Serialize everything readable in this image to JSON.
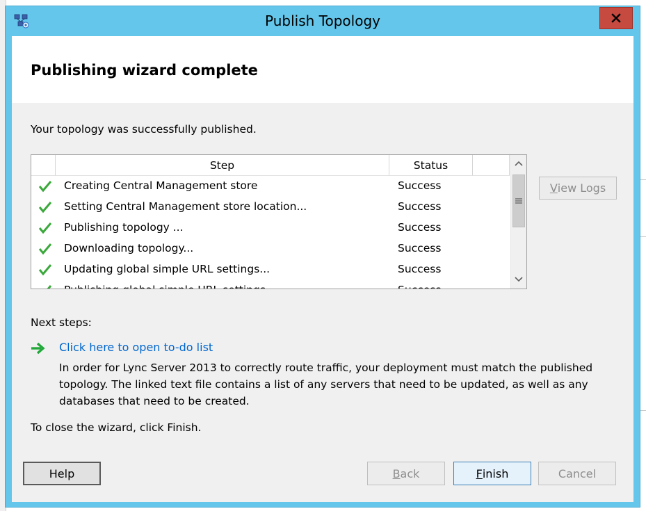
{
  "window": {
    "title": "Publish Topology",
    "close_label": "x"
  },
  "header": {
    "title": "Publishing wizard complete"
  },
  "intro_text": "Your topology was successfully published.",
  "steps_table": {
    "columns": [
      "Step",
      "Status"
    ],
    "rows": [
      {
        "step": "Creating Central Management store",
        "status": "Success"
      },
      {
        "step": "Setting Central Management store location...",
        "status": "Success"
      },
      {
        "step": "Publishing topology ...",
        "status": "Success"
      },
      {
        "step": "Downloading topology...",
        "status": "Success"
      },
      {
        "step": "Updating global simple URL settings...",
        "status": "Success"
      },
      {
        "step": "Publishing global simple URL settings...",
        "status": "Success"
      }
    ]
  },
  "view_logs_button": {
    "label_underlined": "V",
    "label_rest": "iew Logs"
  },
  "next_steps": {
    "label": "Next steps:",
    "link_text": "Click here to open to-do list",
    "description": "In order for Lync Server 2013 to correctly route traffic, your deployment must match the published topology. The linked text file contains a list of any servers that need to be updated, as well as any databases that need to be created."
  },
  "close_hint": "To close the wizard, click Finish.",
  "buttons": {
    "help": "Help",
    "back_underlined": "B",
    "back_rest": "ack",
    "finish_underlined": "F",
    "finish_rest": "inish",
    "cancel": "Cancel"
  },
  "colors": {
    "titlebar": "#63c6ea",
    "close_button": "#c74a40",
    "link": "#0066cc",
    "check": "#3aa83a"
  }
}
